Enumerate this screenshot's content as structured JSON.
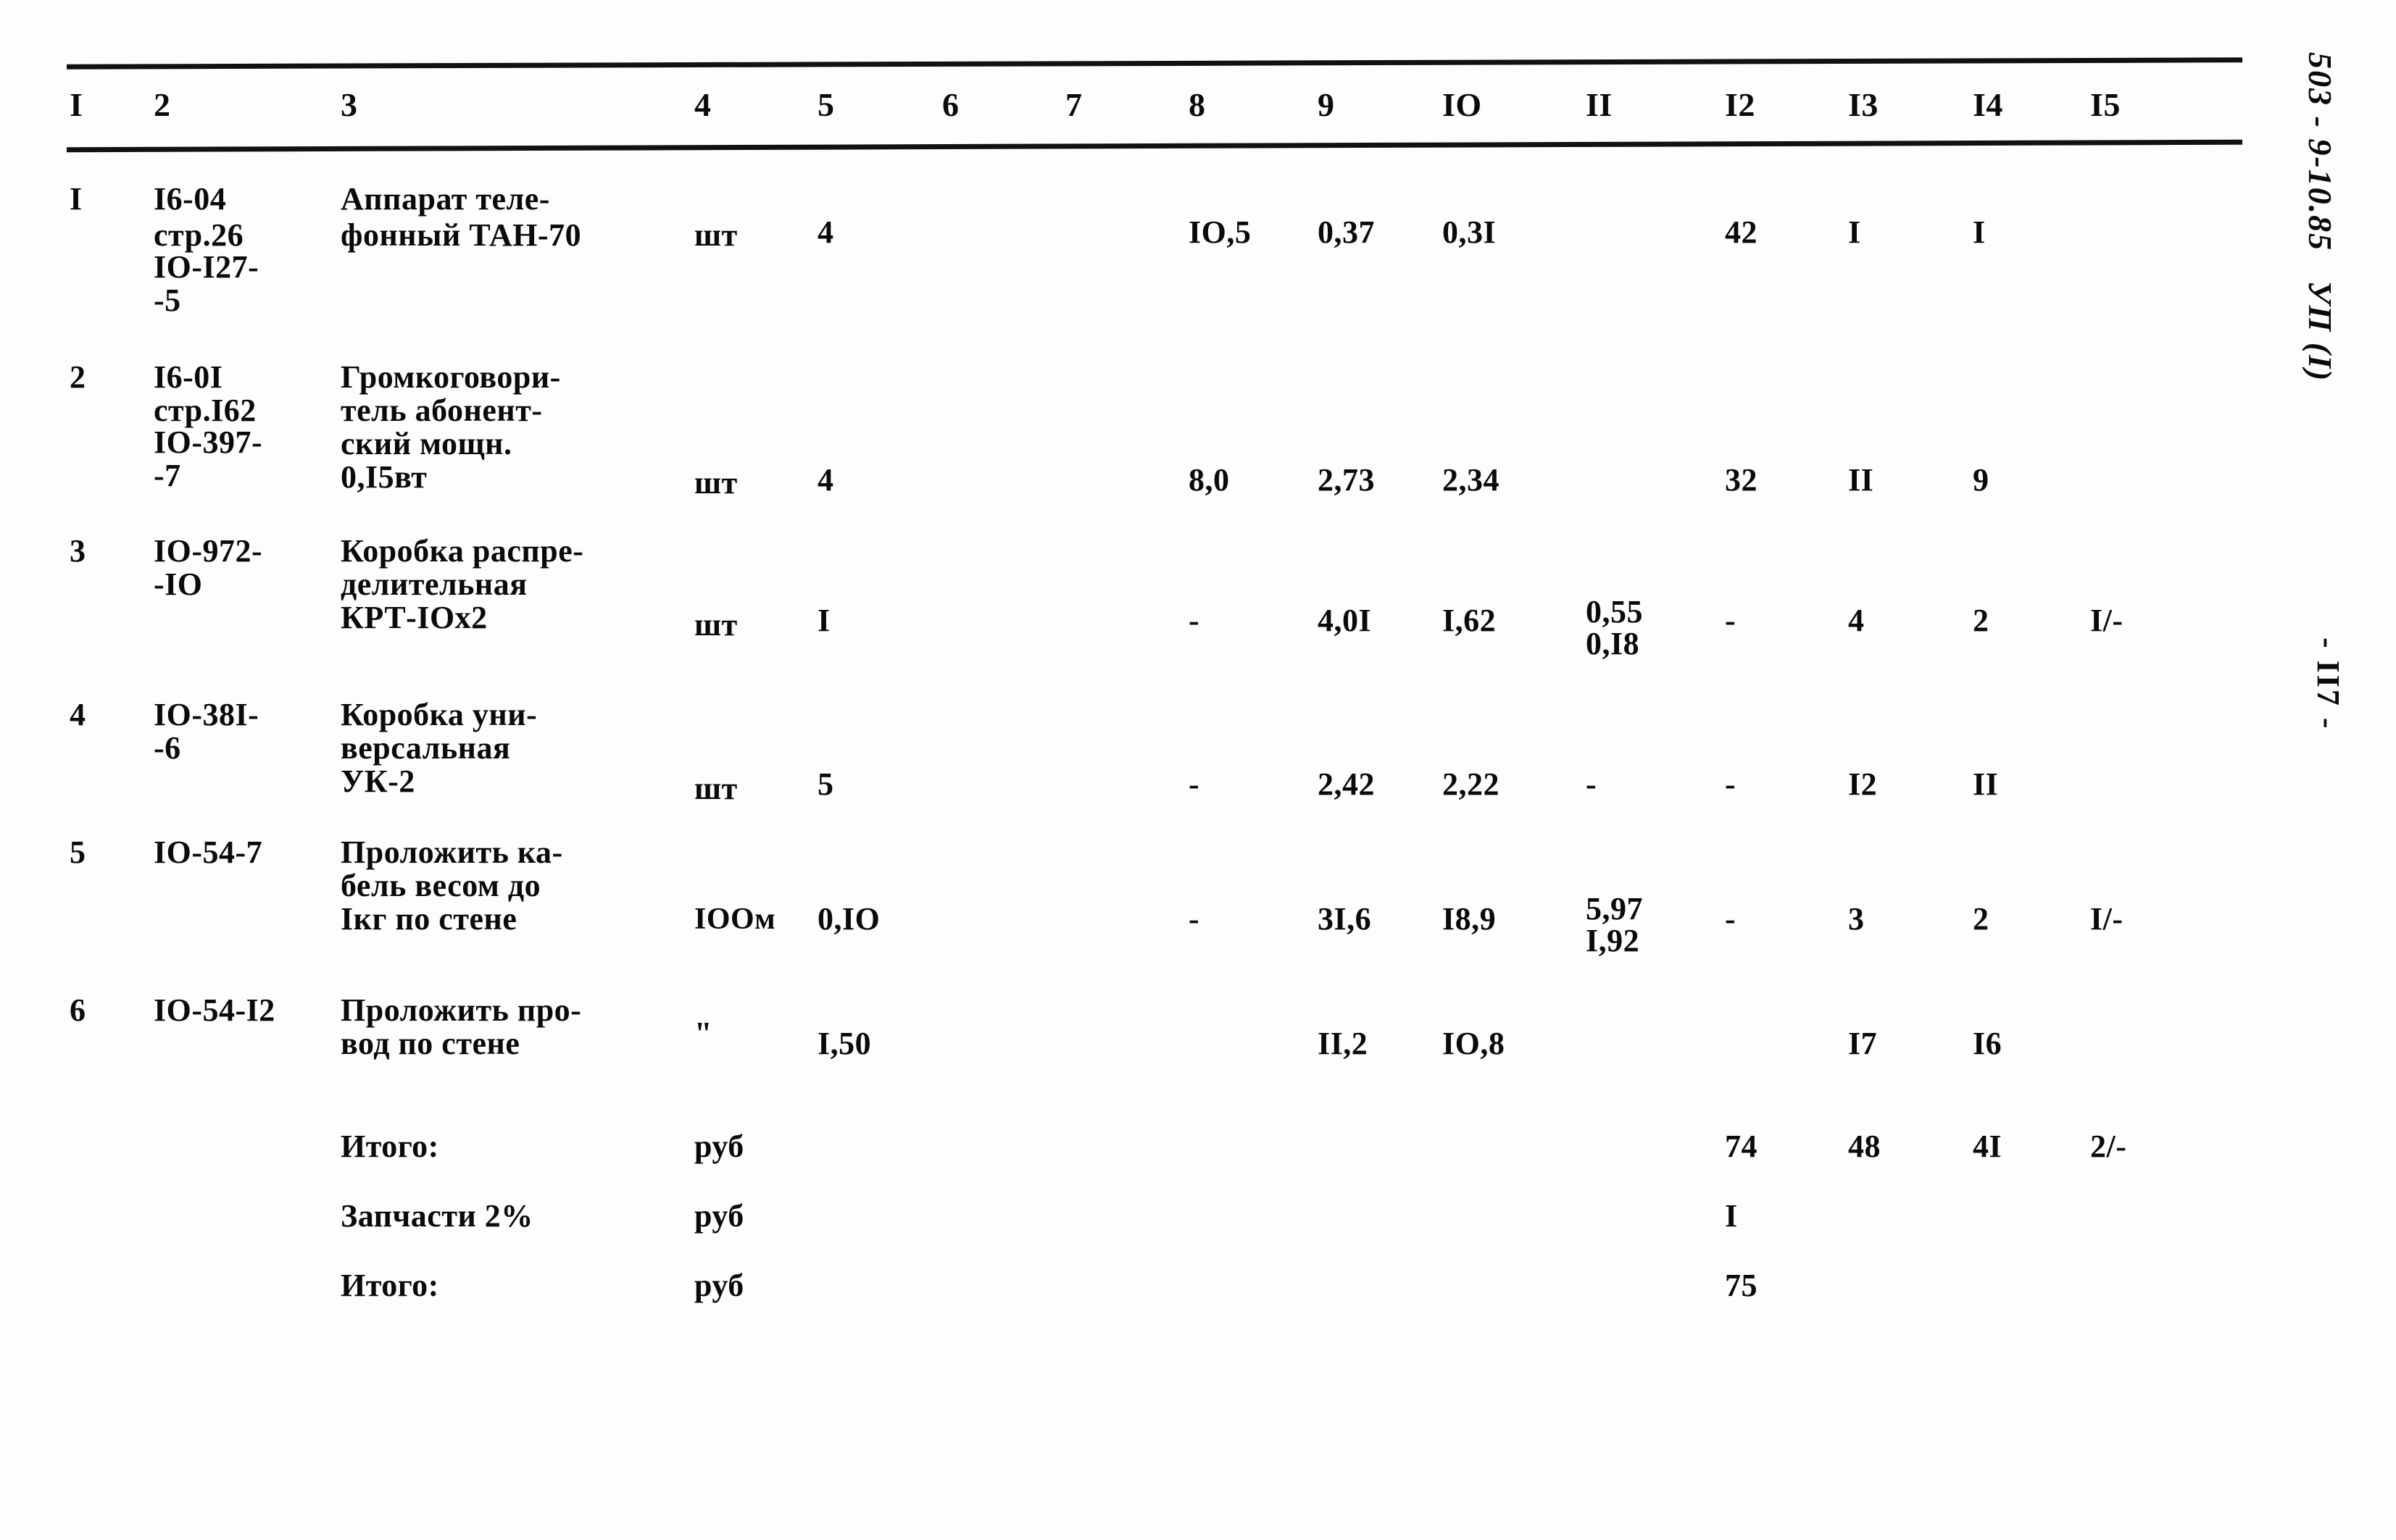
{
  "document": {
    "margin_code": "503 - 9-10.85   УП (I)",
    "margin_page": "- II7 -"
  },
  "table": {
    "column_headers": [
      "I",
      "2",
      "3",
      "4",
      "5",
      "6",
      "7",
      "8",
      "9",
      "IO",
      "II",
      "I2",
      "I3",
      "I4",
      "I5"
    ],
    "rows": [
      {
        "num": "I",
        "code_lines": [
          "I6-04",
          "стр.26",
          "IO-I27-",
          "-5"
        ],
        "name_lines": [
          "Аппарат теле-",
          "фонный ТАН-70"
        ],
        "unit": "шт",
        "c5": "4",
        "c6": "",
        "c7": "",
        "c8": "IO,5",
        "c9": "0,37",
        "c10": "0,3I",
        "c11": "",
        "c11b": "",
        "c12": "42",
        "c13": "I",
        "c14": "I",
        "c15": ""
      },
      {
        "num": "2",
        "code_lines": [
          "I6-0I",
          "стр.I62",
          "IO-397-",
          "-7"
        ],
        "name_lines": [
          "Громкоговори-",
          "тель абонент-",
          "ский мощн.",
          "0,I5вт"
        ],
        "unit": "шт",
        "c5": "4",
        "c6": "",
        "c7": "",
        "c8": "8,0",
        "c9": "2,73",
        "c10": "2,34",
        "c11": "",
        "c11b": "",
        "c12": "32",
        "c13": "II",
        "c14": "9",
        "c15": ""
      },
      {
        "num": "3",
        "code_lines": [
          "IO-972-",
          "-IO"
        ],
        "name_lines": [
          "Коробка распре-",
          "делительная",
          "КРТ-IOх2"
        ],
        "unit": "шт",
        "c5": "I",
        "c6": "",
        "c7": "",
        "c8": "-",
        "c9": "4,0I",
        "c10": "I,62",
        "c11": "0,55",
        "c11b": "0,I8",
        "c12": "-",
        "c13": "4",
        "c14": "2",
        "c15": "I/-"
      },
      {
        "num": "4",
        "code_lines": [
          "IO-38I-",
          "-6"
        ],
        "name_lines": [
          "Коробка уни-",
          "версальная",
          "УК-2"
        ],
        "unit": "шт",
        "c5": "5",
        "c6": "",
        "c7": "",
        "c8": "-",
        "c9": "2,42",
        "c10": "2,22",
        "c11": "-",
        "c11b": "",
        "c12": "-",
        "c13": "I2",
        "c14": "II",
        "c15": ""
      },
      {
        "num": "5",
        "code_lines": [
          "IO-54-7"
        ],
        "name_lines": [
          "Проложить ка-",
          "бель весом до",
          "Iкг по стене"
        ],
        "unit": "IOOм",
        "c5": "0,IO",
        "c6": "",
        "c7": "",
        "c8": "-",
        "c9": "3I,6",
        "c10": "I8,9",
        "c11": "5,97",
        "c11b": "I,92",
        "c12": "-",
        "c13": "3",
        "c14": "2",
        "c15": "I/-"
      },
      {
        "num": "6",
        "code_lines": [
          "IO-54-I2"
        ],
        "name_lines": [
          "Проложить про-",
          "вод по стене"
        ],
        "unit": "\"",
        "c5": "I,50",
        "c6": "",
        "c7": "",
        "c8": "",
        "c9": "II,2",
        "c10": "IO,8",
        "c11": "",
        "c11b": "",
        "c12": "",
        "c13": "I7",
        "c14": "I6",
        "c15": ""
      }
    ],
    "summary_rows": [
      {
        "label": "Итого:",
        "unit": "руб",
        "c12": "74",
        "c13": "48",
        "c14": "4I",
        "c15": "2/-"
      },
      {
        "label": "Запчасти 2%",
        "unit": "руб",
        "c12": "I",
        "c13": "",
        "c14": "",
        "c15": ""
      },
      {
        "label": "Итого:",
        "unit": "руб",
        "c12": "75",
        "c13": "",
        "c14": "",
        "c15": ""
      }
    ]
  }
}
